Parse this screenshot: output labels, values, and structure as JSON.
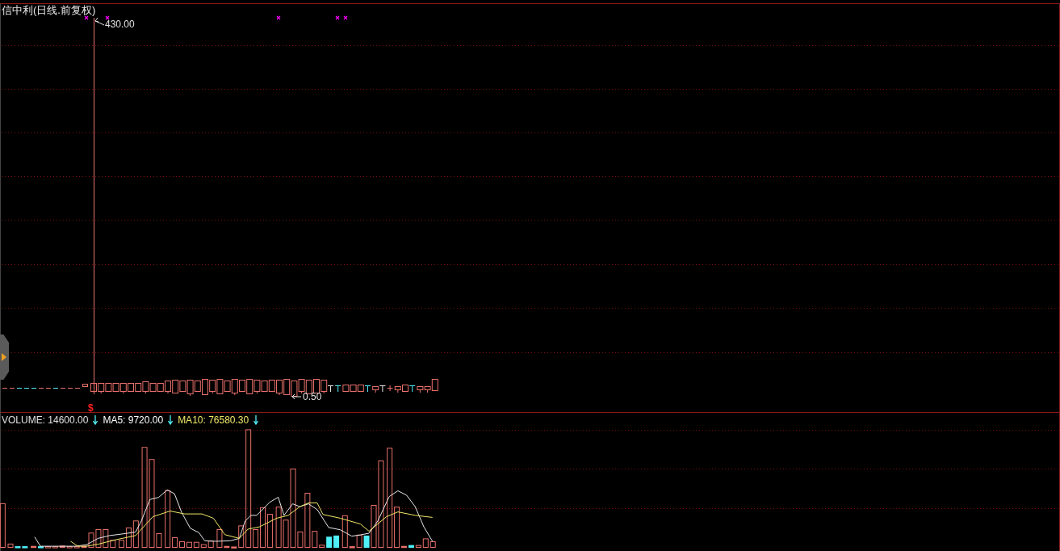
{
  "title": "信中利(日线.前复权)",
  "price_pane": {
    "high_label": "430.00",
    "low_label": "0.50",
    "signal_marker": "$"
  },
  "volume_legend": [
    {
      "label": "VOLUME: 14600.00",
      "color": "#e0e0e0"
    },
    {
      "label": "MA5: 9720.00",
      "color": "#ffffff"
    },
    {
      "label": "MA10: 76580.30",
      "color": "#f0e868"
    }
  ]
}
